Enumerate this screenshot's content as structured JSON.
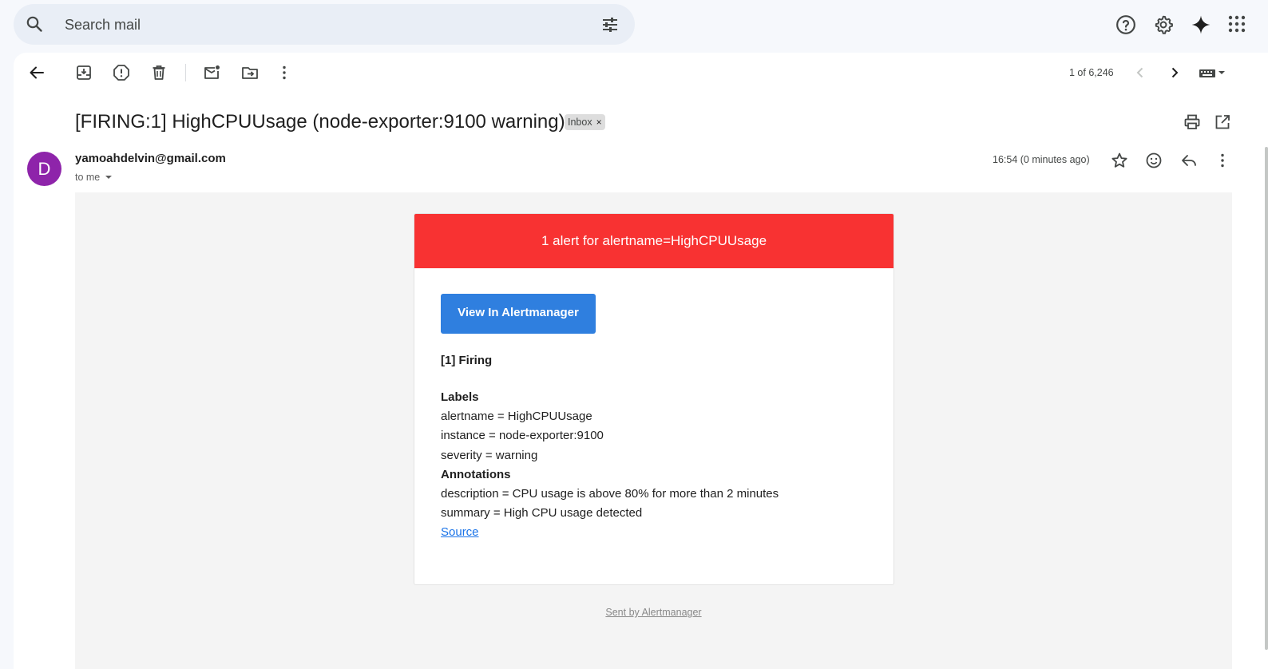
{
  "search": {
    "placeholder": "Search mail"
  },
  "toolbar": {
    "pager": "1 of 6,246"
  },
  "email": {
    "subject": "[FIRING:1] HighCPUUsage (node-exporter:9100 warning)",
    "label": "Inbox",
    "label_remove": "×",
    "avatar_letter": "D",
    "sender": "yamoahdelvin@gmail.com",
    "recipient": "to me",
    "timestamp": "16:54 (0 minutes ago)"
  },
  "alert": {
    "header": "1 alert for alertname=HighCPUUsage",
    "header_color": "#f83232",
    "button": "View In Alertmanager",
    "button_color": "#2f7fdf",
    "firing": "[1] Firing",
    "labels_title": "Labels",
    "labels": [
      "alertname = HighCPUUsage",
      "instance = node-exporter:9100",
      "severity = warning"
    ],
    "annotations_title": "Annotations",
    "annotations": [
      "description = CPU usage is above 80% for more than 2 minutes",
      "summary = High CPU usage detected"
    ],
    "source": "Source",
    "footer": "Sent by Alertmanager"
  },
  "icons": [
    "search-icon",
    "tune-icon",
    "help-icon",
    "settings-icon",
    "gemini-icon",
    "apps-icon",
    "back-icon",
    "archive-icon",
    "report-spam-icon",
    "delete-icon",
    "mark-unread-icon",
    "move-to-icon",
    "more-icon",
    "prev-icon",
    "next-icon",
    "keyboard-icon",
    "print-icon",
    "open-new-window-icon",
    "star-icon",
    "emoji-icon",
    "reply-icon"
  ]
}
